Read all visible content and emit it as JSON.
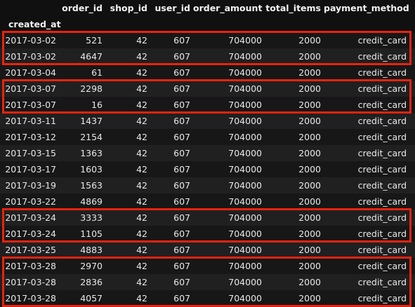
{
  "table": {
    "columns": [
      "order_id",
      "shop_id",
      "user_id",
      "order_amount",
      "total_items",
      "payment_method"
    ],
    "index_name": "created_at",
    "rows": [
      {
        "created_at": "2017-03-02",
        "order_id": "521",
        "shop_id": "42",
        "user_id": "607",
        "order_amount": "704000",
        "total_items": "2000",
        "payment_method": "credit_card"
      },
      {
        "created_at": "2017-03-02",
        "order_id": "4647",
        "shop_id": "42",
        "user_id": "607",
        "order_amount": "704000",
        "total_items": "2000",
        "payment_method": "credit_card"
      },
      {
        "created_at": "2017-03-04",
        "order_id": "61",
        "shop_id": "42",
        "user_id": "607",
        "order_amount": "704000",
        "total_items": "2000",
        "payment_method": "credit_card"
      },
      {
        "created_at": "2017-03-07",
        "order_id": "2298",
        "shop_id": "42",
        "user_id": "607",
        "order_amount": "704000",
        "total_items": "2000",
        "payment_method": "credit_card"
      },
      {
        "created_at": "2017-03-07",
        "order_id": "16",
        "shop_id": "42",
        "user_id": "607",
        "order_amount": "704000",
        "total_items": "2000",
        "payment_method": "credit_card"
      },
      {
        "created_at": "2017-03-11",
        "order_id": "1437",
        "shop_id": "42",
        "user_id": "607",
        "order_amount": "704000",
        "total_items": "2000",
        "payment_method": "credit_card"
      },
      {
        "created_at": "2017-03-12",
        "order_id": "2154",
        "shop_id": "42",
        "user_id": "607",
        "order_amount": "704000",
        "total_items": "2000",
        "payment_method": "credit_card"
      },
      {
        "created_at": "2017-03-15",
        "order_id": "1363",
        "shop_id": "42",
        "user_id": "607",
        "order_amount": "704000",
        "total_items": "2000",
        "payment_method": "credit_card"
      },
      {
        "created_at": "2017-03-17",
        "order_id": "1603",
        "shop_id": "42",
        "user_id": "607",
        "order_amount": "704000",
        "total_items": "2000",
        "payment_method": "credit_card"
      },
      {
        "created_at": "2017-03-19",
        "order_id": "1563",
        "shop_id": "42",
        "user_id": "607",
        "order_amount": "704000",
        "total_items": "2000",
        "payment_method": "credit_card"
      },
      {
        "created_at": "2017-03-22",
        "order_id": "4869",
        "shop_id": "42",
        "user_id": "607",
        "order_amount": "704000",
        "total_items": "2000",
        "payment_method": "credit_card"
      },
      {
        "created_at": "2017-03-24",
        "order_id": "3333",
        "shop_id": "42",
        "user_id": "607",
        "order_amount": "704000",
        "total_items": "2000",
        "payment_method": "credit_card"
      },
      {
        "created_at": "2017-03-24",
        "order_id": "1105",
        "shop_id": "42",
        "user_id": "607",
        "order_amount": "704000",
        "total_items": "2000",
        "payment_method": "credit_card"
      },
      {
        "created_at": "2017-03-25",
        "order_id": "4883",
        "shop_id": "42",
        "user_id": "607",
        "order_amount": "704000",
        "total_items": "2000",
        "payment_method": "credit_card"
      },
      {
        "created_at": "2017-03-28",
        "order_id": "2970",
        "shop_id": "42",
        "user_id": "607",
        "order_amount": "704000",
        "total_items": "2000",
        "payment_method": "credit_card"
      },
      {
        "created_at": "2017-03-28",
        "order_id": "2836",
        "shop_id": "42",
        "user_id": "607",
        "order_amount": "704000",
        "total_items": "2000",
        "payment_method": "credit_card"
      },
      {
        "created_at": "2017-03-28",
        "order_id": "4057",
        "shop_id": "42",
        "user_id": "607",
        "order_amount": "704000",
        "total_items": "2000",
        "payment_method": "credit_card"
      }
    ],
    "highlight_groups": [
      {
        "date": "2017-03-02",
        "row_indices": [
          0,
          1
        ]
      },
      {
        "date": "2017-03-07",
        "row_indices": [
          3,
          4
        ]
      },
      {
        "date": "2017-03-24",
        "row_indices": [
          11,
          12
        ]
      },
      {
        "date": "2017-03-28",
        "row_indices": [
          14,
          15,
          16
        ]
      }
    ]
  },
  "colors": {
    "background": "#101010",
    "row_odd": "#171717",
    "row_even": "#202020",
    "highlight_border": "#e8230f",
    "text": "#e8e8e8"
  }
}
